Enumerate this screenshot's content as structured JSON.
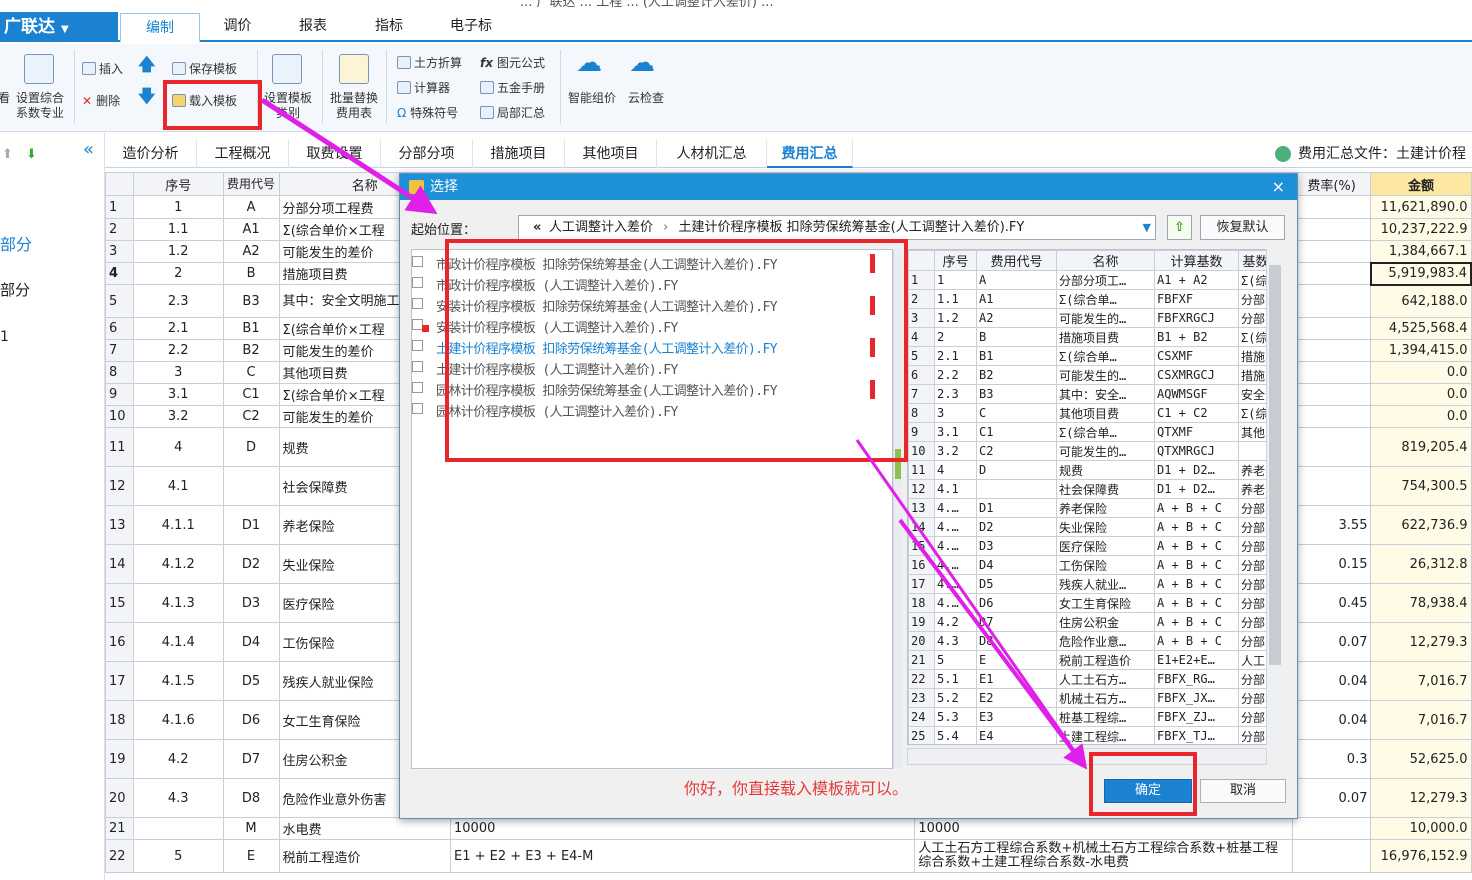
{
  "app": {
    "title_fragment": "... 广联达 ... 工程 ... (人工调整计入差价) ...",
    "logo": "广联达",
    "menus": [
      "编制",
      "调价",
      "报表",
      "指标",
      "电子标"
    ],
    "active_menu": "编制"
  },
  "ribbon": {
    "settings_left": "设置综合",
    "settings_left2": "系数专业",
    "insert": "插入",
    "delete": "删除",
    "save_template": "保存模板",
    "load_template": "载入模板",
    "set_template_cat1": "设置模板",
    "set_template_cat2": "类别",
    "batch_replace1": "批量替换",
    "batch_replace2": "费用表",
    "earthwork": "土方折算",
    "formula": "图元公式",
    "calculator": "计算器",
    "hardware": "五金手册",
    "special": "特殊符号",
    "partial": "局部汇总",
    "smart_price": "智能组价",
    "cloud_check": "云检查"
  },
  "tabs": [
    "造价分析",
    "工程概况",
    "取费设置",
    "分部分项",
    "措施项目",
    "其他项目",
    "人材机汇总",
    "费用汇总"
  ],
  "active_tab": "费用汇总",
  "file_label": "费用汇总文件：土建计价程",
  "left_panel": [
    "部分",
    "部分",
    "1"
  ],
  "main_table": {
    "headers": [
      "序号",
      "费用代号",
      "名称",
      "费率(%)",
      "金额"
    ],
    "rows": [
      [
        "1",
        "1",
        "A",
        "分部分项工程费",
        "",
        "11,621,890.0"
      ],
      [
        "2",
        "1.1",
        "A1",
        "Σ(综合单价×工程",
        "",
        "10,237,222.9"
      ],
      [
        "3",
        "1.2",
        "A2",
        "可能发生的差价",
        "",
        "1,384,667.1"
      ],
      [
        "4",
        "2",
        "B",
        "措施项目费",
        "",
        "5,919,983.4"
      ],
      [
        "5",
        "2.3",
        "B3",
        "其中：安全文明施工费",
        "",
        "642,188.0"
      ],
      [
        "6",
        "2.1",
        "B1",
        "Σ(综合单价×工程",
        "",
        "4,525,568.4"
      ],
      [
        "7",
        "2.2",
        "B2",
        "可能发生的差价",
        "",
        "1,394,415.0"
      ],
      [
        "8",
        "3",
        "C",
        "其他项目费",
        "",
        "0.0"
      ],
      [
        "9",
        "3.1",
        "C1",
        "Σ(综合单价×工程",
        "",
        "0.0"
      ],
      [
        "10",
        "3.2",
        "C2",
        "可能发生的差价",
        "",
        "0.0"
      ],
      [
        "11",
        "4",
        "D",
        "规费",
        "",
        "819,205.4"
      ],
      [
        "12",
        "4.1",
        "",
        "社会保障费",
        "",
        "754,300.5"
      ],
      [
        "13",
        "4.1.1",
        "D1",
        "养老保险",
        "3.55",
        "622,736.9"
      ],
      [
        "14",
        "4.1.2",
        "D2",
        "失业保险",
        "0.15",
        "26,312.8"
      ],
      [
        "15",
        "4.1.3",
        "D3",
        "医疗保险",
        "0.45",
        "78,938.4"
      ],
      [
        "16",
        "4.1.4",
        "D4",
        "工伤保险",
        "0.07",
        "12,279.3"
      ],
      [
        "17",
        "4.1.5",
        "D5",
        "残疾人就业保险",
        "0.04",
        "7,016.7"
      ],
      [
        "18",
        "4.1.6",
        "D6",
        "女工生育保险",
        "0.04",
        "7,016.7"
      ],
      [
        "19",
        "4.2",
        "D7",
        "住房公积金",
        "0.3",
        "52,625.0"
      ],
      [
        "20",
        "4.3",
        "D8",
        "危险作业意外伤害",
        "0.07",
        "12,279.3"
      ]
    ],
    "row21": {
      "rn": "21",
      "code": "M",
      "name": "水电费",
      "expr": "10000",
      "expr2": "10000",
      "amount": "10,000.0"
    },
    "row22": {
      "rn": "22",
      "seq": "5",
      "code": "E",
      "name": "税前工程造价",
      "expr": "E1 + E2 + E3 + E4-M",
      "expr2": "人工土石方工程综合系数+机械土石方工程综合系数+桩基工程综合系数+土建工程综合系数-水电费",
      "amount": "16,976,152.9"
    }
  },
  "dialog": {
    "title": "选择",
    "close": "×",
    "start_label": "起始位置：",
    "path_back": "«",
    "path_seg1": "人工调整计入差价",
    "path_sep": "›",
    "path_seg2": "土建计价程序模板 扣除劳保统筹基金(人工调整计入差价).FY",
    "path_dropdown": "▼",
    "restore": "恢复默认",
    "files": [
      "市政计价程序模板 扣除劳保统筹基金(人工调整计入差价).FY",
      "市政计价程序模板 (人工调整计入差价).FY",
      "安装计价程序模板 扣除劳保统筹基金(人工调整计入差价).FY",
      "安装计价程序模板 (人工调整计入差价).FY",
      "土建计价程序模板 扣除劳保统筹基金(人工调整计入差价).FY",
      "土建计价程序模板 (人工调整计入差价).FY",
      "园林计价程序模板 扣除劳保统筹基金(人工调整计入差价).FY",
      "园林计价程序模板 (人工调整计入差价).FY"
    ],
    "selected_file_index": 4,
    "preview_headers": [
      "",
      "序号",
      "费用代号",
      "名称",
      "计算基数",
      "基数"
    ],
    "preview_rows": [
      [
        "1",
        "1",
        "A",
        "分部分项工…",
        "A1 + A2",
        "Σ(综"
      ],
      [
        "2",
        "1.1",
        "A1",
        "Σ(综合单…",
        "FBFXF",
        "分部"
      ],
      [
        "3",
        "1.2",
        "A2",
        "可能发生的…",
        "FBFXRGCJ",
        "分部"
      ],
      [
        "4",
        "2",
        "B",
        "措施项目费",
        "B1 + B2",
        "Σ(综"
      ],
      [
        "5",
        "2.1",
        "B1",
        "Σ(综合单…",
        "CSXMF",
        "措施"
      ],
      [
        "6",
        "2.2",
        "B2",
        "可能发生的…",
        "CSXMRGCJ",
        "措施"
      ],
      [
        "7",
        "2.3",
        "B3",
        "其中：安全…",
        "AQWMSGF",
        "安全"
      ],
      [
        "8",
        "3",
        "C",
        "其他项目费",
        "C1 + C2",
        "Σ(综"
      ],
      [
        "9",
        "3.1",
        "C1",
        "Σ(综合单…",
        "QTXMF",
        "其他"
      ],
      [
        "10",
        "3.2",
        "C2",
        "可能发生的…",
        "QTXMRGCJ",
        ""
      ],
      [
        "11",
        "4",
        "D",
        "规费",
        "D1 + D2…",
        "养老"
      ],
      [
        "12",
        "4.1",
        "",
        "社会保障费",
        "D1 + D2…",
        "养老"
      ],
      [
        "13",
        "4.…",
        "D1",
        "养老保险",
        "A + B + C",
        "分部"
      ],
      [
        "14",
        "4.…",
        "D2",
        "失业保险",
        "A + B + C",
        "分部"
      ],
      [
        "15",
        "4.…",
        "D3",
        "医疗保险",
        "A + B + C",
        "分部"
      ],
      [
        "16",
        "4.…",
        "D4",
        "工伤保险",
        "A + B + C",
        "分部"
      ],
      [
        "17",
        "4.…",
        "D5",
        "残疾人就业…",
        "A + B + C",
        "分部"
      ],
      [
        "18",
        "4.…",
        "D6",
        "女工生育保险",
        "A + B + C",
        "分部"
      ],
      [
        "19",
        "4.2",
        "D7",
        "住房公积金",
        "A + B + C",
        "分部"
      ],
      [
        "20",
        "4.3",
        "D8",
        "危险作业意…",
        "A + B + C",
        "分部"
      ],
      [
        "21",
        "5",
        "E",
        "税前工程造价",
        "E1+E2+E…",
        "人工"
      ],
      [
        "22",
        "5.1",
        "E1",
        "人工土石方…",
        "FBFX_RG…",
        "分部"
      ],
      [
        "23",
        "5.2",
        "E2",
        "机械土石方…",
        "FBFX_JX…",
        "分部"
      ],
      [
        "24",
        "5.3",
        "E3",
        "桩基工程综…",
        "FBFX_ZJ…",
        "分部"
      ],
      [
        "25",
        "5.4",
        "E4",
        "土建工程综…",
        "FBFX_TJ…",
        "分部"
      ]
    ],
    "note": "你好，你直接载入模板就可以。",
    "ok": "确定",
    "cancel": "取消"
  },
  "colors": {
    "accent": "#1b82d1",
    "annotation": "#e8262c",
    "arrow": "#e020e8",
    "amount_header": "#fde7a3"
  }
}
